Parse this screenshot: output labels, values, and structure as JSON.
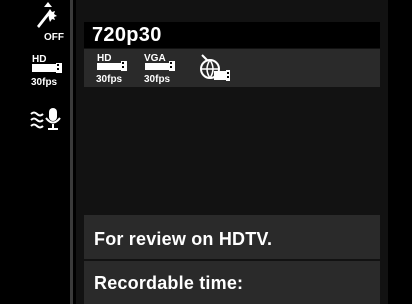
{
  "sidebar": {
    "items": [
      {
        "icon": "flash-off-icon",
        "label": "OFF"
      },
      {
        "icon": "hd-movie-30fps-icon",
        "label_top": "HD",
        "label_bottom": "30fps"
      },
      {
        "icon": "wind-filter-mic-icon"
      }
    ]
  },
  "menu": {
    "title": "720p30",
    "options": [
      {
        "icon": "hd-movie-30fps-icon",
        "label_top": "HD",
        "label_bottom": "30fps"
      },
      {
        "icon": "vga-movie-30fps-icon",
        "label_top": "VGA",
        "label_bottom": "30fps"
      },
      {
        "icon": "web-movie-icon"
      }
    ]
  },
  "footer": {
    "description": "For review on HDTV.",
    "recordable_label": "Recordable time:"
  },
  "colors": {
    "panel": "#121212",
    "highlight": "#000000",
    "band": "#2a2a2a",
    "text": "#ffffff"
  }
}
